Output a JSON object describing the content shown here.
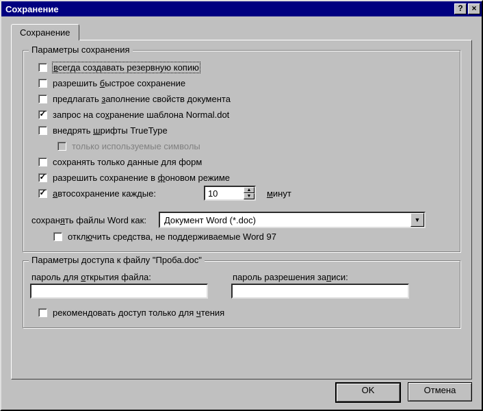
{
  "window": {
    "title": "Сохранение"
  },
  "tab": {
    "label": "Сохранение"
  },
  "group_save": {
    "legend": "Параметры сохранения",
    "opt_backup": "всегда создавать резервную копию",
    "opt_fastsave": "разрешить быстрое сохранение",
    "opt_prompt_props": "предлагать заполнение свойств документа",
    "opt_prompt_normal": "запрос на сохранение шаблона Normal.dot",
    "opt_embed_tt": "внедрять шрифты TrueType",
    "opt_embed_used_only": "только используемые символы",
    "opt_forms_data": "сохранять только данные для форм",
    "opt_bg_save": "разрешить сохранение в фоновом режиме",
    "opt_autosave": "автосохранение каждые:",
    "autosave_value": "10",
    "autosave_unit": "минут",
    "save_as_label": "сохранять файлы Word как:",
    "save_as_value": "Документ Word (*.doc)",
    "opt_disable97": "отключить средства, не поддерживаемые Word 97",
    "checked": {
      "backup": false,
      "fastsave": false,
      "prompt_props": false,
      "prompt_normal": true,
      "embed_tt": false,
      "embed_used_only": false,
      "forms_data": false,
      "bg_save": true,
      "autosave": true,
      "disable97": false
    }
  },
  "group_access": {
    "legend": "Параметры доступа к файлу \"Проба.doc\"",
    "lbl_open_pw": "пароль для открытия файла:",
    "lbl_write_pw": "пароль разрешения записи:",
    "open_pw": "",
    "write_pw": "",
    "opt_readonly": "рекомендовать доступ только для чтения",
    "readonly_checked": false
  },
  "buttons": {
    "ok": "OK",
    "cancel": "Отмена"
  }
}
